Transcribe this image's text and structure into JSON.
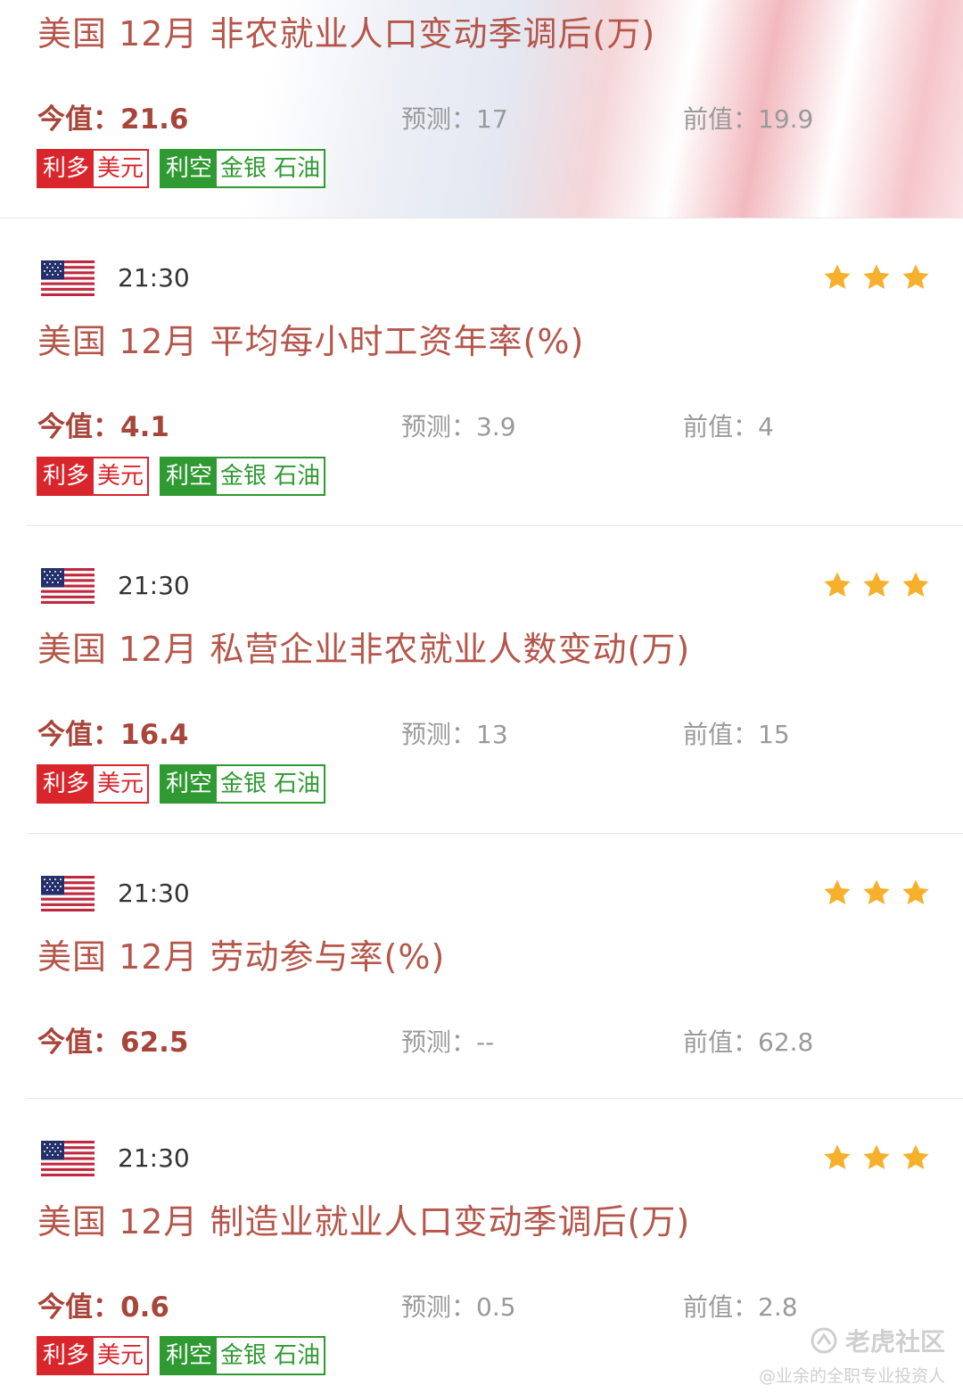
{
  "events": [
    {
      "title": "美国 12月 非农就业人口变动季调后(万)",
      "actual": "今值：21.6",
      "forecast": "预测：17",
      "previous": "前值：19.9",
      "tags": {
        "bull_label": "利多",
        "bull_items": [
          "美元"
        ],
        "bear_label": "利空",
        "bear_items": [
          "金银",
          "石油"
        ]
      }
    },
    {
      "time": "21:30",
      "flag_icon": "us-flag-icon",
      "stars": 3,
      "title": "美国 12月 平均每小时工资年率(%)",
      "actual": "今值：4.1",
      "forecast": "预测：3.9",
      "previous": "前值：4",
      "tags": {
        "bull_label": "利多",
        "bull_items": [
          "美元"
        ],
        "bear_label": "利空",
        "bear_items": [
          "金银",
          "石油"
        ]
      }
    },
    {
      "time": "21:30",
      "flag_icon": "us-flag-icon",
      "stars": 3,
      "title": "美国 12月 私营企业非农就业人数变动(万)",
      "actual": "今值：16.4",
      "forecast": "预测：13",
      "previous": "前值：15",
      "tags": {
        "bull_label": "利多",
        "bull_items": [
          "美元"
        ],
        "bear_label": "利空",
        "bear_items": [
          "金银",
          "石油"
        ]
      }
    },
    {
      "time": "21:30",
      "flag_icon": "us-flag-icon",
      "stars": 3,
      "title": "美国 12月 劳动参与率(%)",
      "actual": "今值：62.5",
      "forecast": "预测：--",
      "previous": "前值：62.8"
    },
    {
      "time": "21:30",
      "flag_icon": "us-flag-icon",
      "stars": 3,
      "title": "美国 12月 制造业就业人口变动季调后(万)",
      "actual": "今值：0.6",
      "forecast": "预测：0.5",
      "previous": "前值：2.8",
      "tags": {
        "bull_label": "利多",
        "bull_items": [
          "美元"
        ],
        "bear_label": "利空",
        "bear_items": [
          "金银",
          "石油"
        ]
      }
    }
  ],
  "watermark": {
    "brand": "老虎社区",
    "user": "@业余的全职专业投资人"
  },
  "colors": {
    "bull": "#d9262c",
    "bear": "#2f9a31",
    "title": "#b5564b",
    "star": "#f6b02b"
  }
}
